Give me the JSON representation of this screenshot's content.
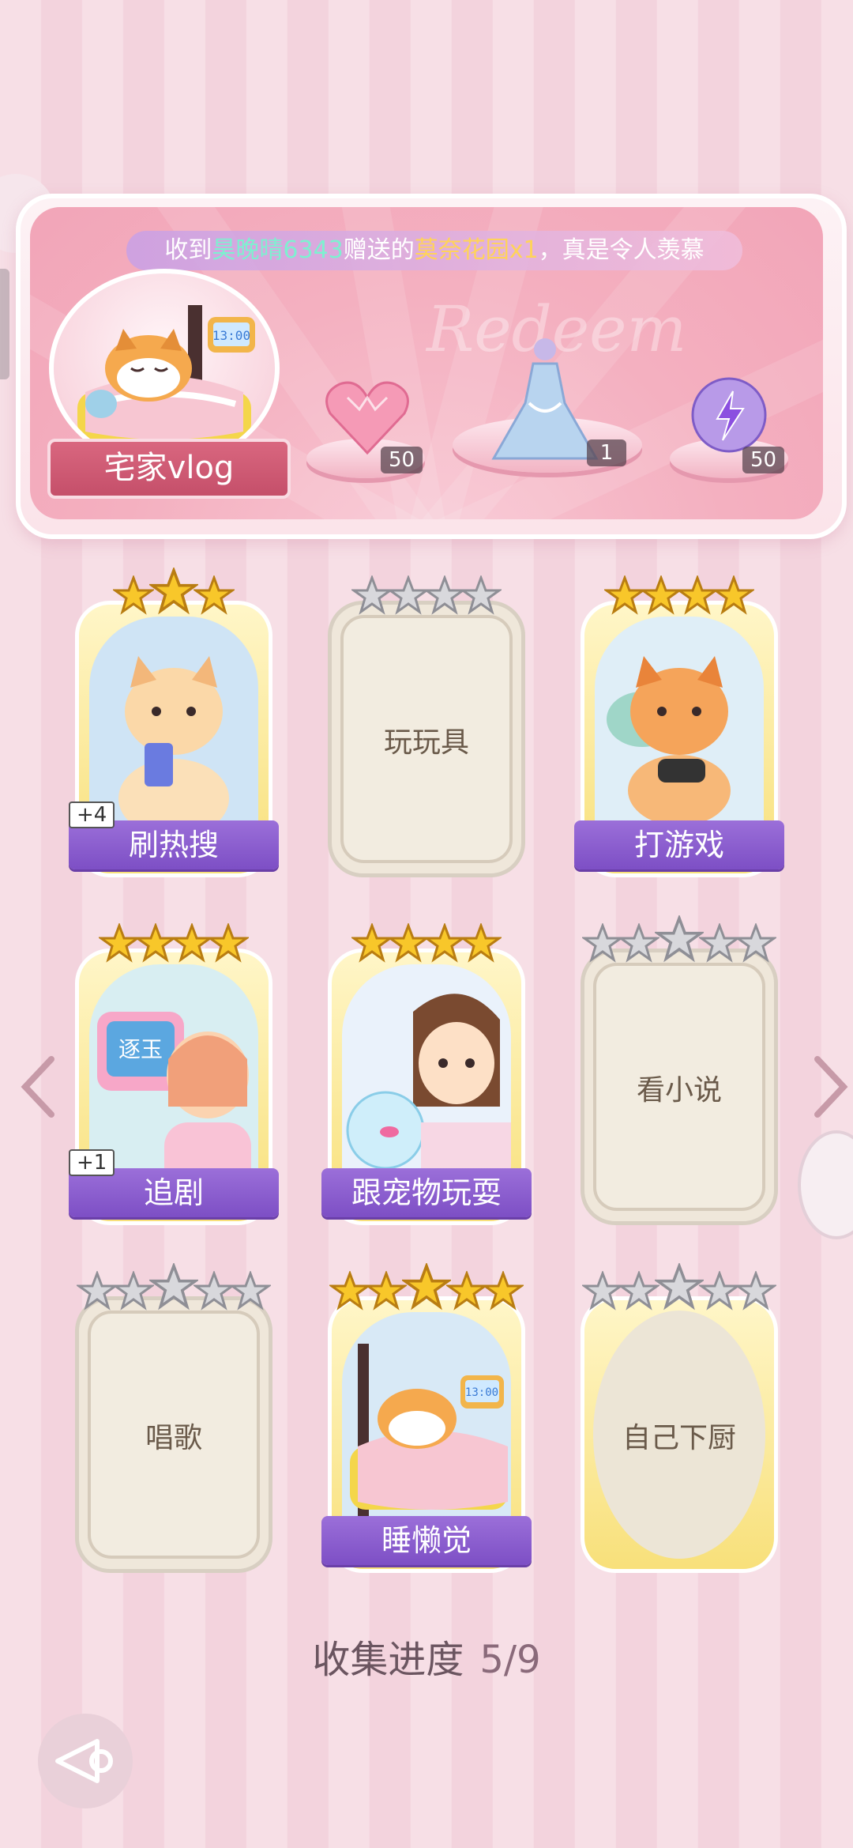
{
  "banner": {
    "ticker": {
      "prefix": "收到",
      "user": "昊晚晴6343",
      "middle": "赠送的",
      "gift": "莫奈花园x1",
      "suffix": "，真是令人羡慕"
    },
    "watermark": "Redeem",
    "avatar_label": "宅家vlog",
    "rewards": [
      {
        "icon": "pink-heart-gem-icon",
        "count": "50"
      },
      {
        "icon": "dress-outfit-icon",
        "count": "1"
      },
      {
        "icon": "energy-orb-icon",
        "count": "50"
      }
    ]
  },
  "cards": [
    {
      "label": "刷热搜",
      "stars": 3,
      "max_stars": 3,
      "state": "unlocked",
      "badge": "+4"
    },
    {
      "label": "玩玩具",
      "stars": 0,
      "max_stars": 4,
      "state": "locked",
      "badge": ""
    },
    {
      "label": "打游戏",
      "stars": 4,
      "max_stars": 4,
      "state": "unlocked",
      "badge": ""
    },
    {
      "label": "追剧",
      "stars": 4,
      "max_stars": 4,
      "state": "unlocked",
      "badge": "+1",
      "tv_text": "逐玉"
    },
    {
      "label": "跟宠物玩耍",
      "stars": 4,
      "max_stars": 4,
      "state": "unlocked",
      "badge": ""
    },
    {
      "label": "看小说",
      "stars": 0,
      "max_stars": 5,
      "state": "locked",
      "badge": ""
    },
    {
      "label": "唱歌",
      "stars": 0,
      "max_stars": 5,
      "state": "locked",
      "badge": ""
    },
    {
      "label": "睡懒觉",
      "stars": 5,
      "max_stars": 5,
      "state": "unlocked",
      "badge": "",
      "clock": "13:00"
    },
    {
      "label": "自己下厨",
      "stars": 0,
      "max_stars": 5,
      "state": "goldlock",
      "badge": ""
    }
  ],
  "progress": {
    "label": "收集进度",
    "value": "5/9"
  },
  "avatar_clock": "13:00",
  "colors": {
    "ribbon": "#8a5bd0",
    "gold_star": "#f8c72a",
    "grey_star": "#d8d8dc",
    "pink": "#f2a5b8"
  }
}
